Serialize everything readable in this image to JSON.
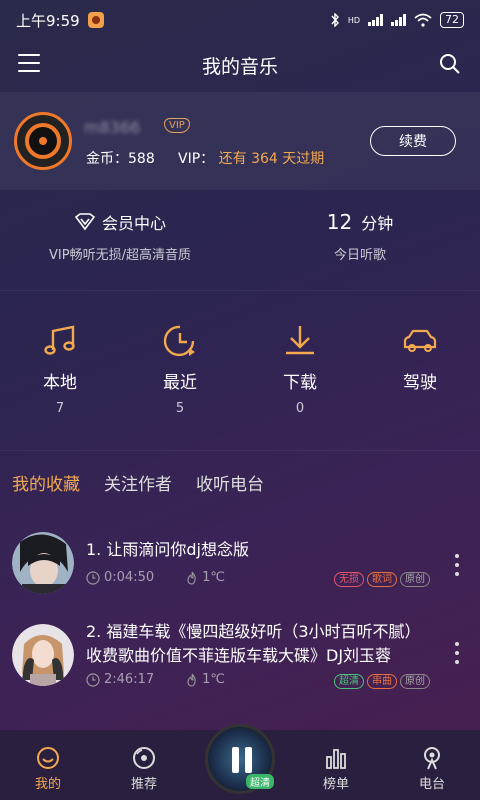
{
  "status_bar": {
    "time": "上午9:59",
    "battery": "72",
    "hd": "HD"
  },
  "header": {
    "title": "我的音乐"
  },
  "profile": {
    "username": "m8366",
    "vip_badge": "VIP",
    "coins_label": "金币：",
    "coins": "588",
    "vip_label": "VIP：",
    "vip_prefix": "还有",
    "vip_days": "364",
    "vip_suffix": "天过期",
    "renew_button": "续费"
  },
  "member_center": {
    "title": "会员中心",
    "subtitle": "VIP畅听无损/超高清音质"
  },
  "listen_today": {
    "minutes": "12",
    "unit": "分钟",
    "subtitle": "今日听歌"
  },
  "shortcuts": [
    {
      "label": "本地",
      "count": "7",
      "icon": "music-note-icon"
    },
    {
      "label": "最近",
      "count": "5",
      "icon": "recent-clock-icon"
    },
    {
      "label": "下载",
      "count": "0",
      "icon": "download-icon"
    },
    {
      "label": "驾驶",
      "count": "",
      "icon": "car-icon"
    }
  ],
  "tabs": [
    {
      "label": "我的收藏",
      "active": true
    },
    {
      "label": "关注作者",
      "active": false
    },
    {
      "label": "收听电台",
      "active": false
    }
  ],
  "songs": [
    {
      "title": "1. 让雨滴问你dj想念版",
      "duration": "0:04:50",
      "heat": "1℃",
      "tags": [
        "无损",
        "歌词",
        "原创"
      ]
    },
    {
      "title": "2. 福建车载《慢四超级好听（3小时百听不腻）收费歌曲价值不菲连版车载大碟》DJ刘玉蓉",
      "duration": "2:46:17",
      "heat": "1℃",
      "tags": [
        "超清",
        "串曲",
        "原创"
      ]
    }
  ],
  "bottom_nav": [
    {
      "label": "我的",
      "active": true
    },
    {
      "label": "推荐",
      "active": false
    },
    {
      "label": "榜单",
      "active": false
    },
    {
      "label": "电台",
      "active": false
    }
  ],
  "player": {
    "quality_badge": "超清"
  },
  "colors": {
    "accent": "#f3a94e",
    "background": "#2b2550"
  }
}
